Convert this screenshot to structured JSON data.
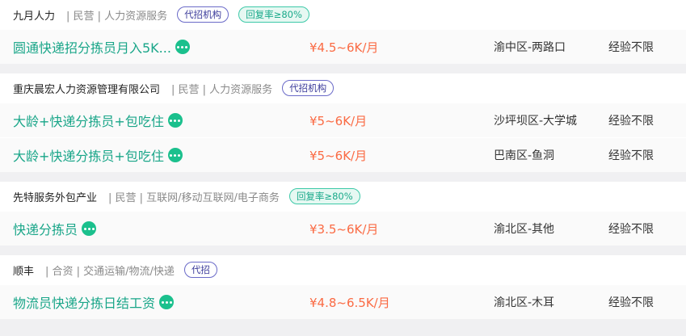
{
  "companies": [
    {
      "name": "九月人力",
      "meta": "| 民营 | 人力资源服务",
      "tags": [
        {
          "label": "代招机构",
          "kind": "agency"
        },
        {
          "label": "回复率≥80%",
          "kind": "reply"
        }
      ],
      "jobs": [
        {
          "title": "圆通快递招分拣员月入5K...",
          "salary": "¥4.5~6K/月",
          "location": "渝中区-两路口",
          "experience": "经验不限"
        }
      ]
    },
    {
      "name": "重庆晨宏人力资源管理有限公司",
      "meta": "| 民营 | 人力资源服务",
      "tags": [
        {
          "label": "代招机构",
          "kind": "agency"
        }
      ],
      "jobs": [
        {
          "title": "大龄+快递分拣员+包吃住",
          "salary": "¥5~6K/月",
          "location": "沙坪坝区-大学城",
          "experience": "经验不限"
        },
        {
          "title": "大龄+快递分拣员+包吃住",
          "salary": "¥5~6K/月",
          "location": "巴南区-鱼洞",
          "experience": "经验不限"
        }
      ]
    },
    {
      "name": "先特服务外包产业",
      "meta": "| 民营 | 互联网/移动互联网/电子商务",
      "tags": [
        {
          "label": "回复率≥80%",
          "kind": "reply"
        }
      ],
      "jobs": [
        {
          "title": "快递分拣员",
          "salary": "¥3.5~6K/月",
          "location": "渝北区-其他",
          "experience": "经验不限"
        }
      ]
    },
    {
      "name": "顺丰",
      "meta": "| 合资 | 交通运输/物流/快递",
      "tags": [
        {
          "label": "代招",
          "kind": "agency"
        }
      ],
      "jobs": [
        {
          "title": "物流员快递分拣日结工资",
          "salary": "¥4.8~6.5K/月",
          "location": "渝北区-木耳",
          "experience": "经验不限"
        }
      ]
    }
  ],
  "colors": {
    "title_green": "#1aa689",
    "salary_orange": "#fa6a43",
    "agency_tag": "#6a6ac8",
    "reply_tag": "#3dc9a8"
  },
  "icons": {
    "chat": "chat-bubble-icon"
  }
}
